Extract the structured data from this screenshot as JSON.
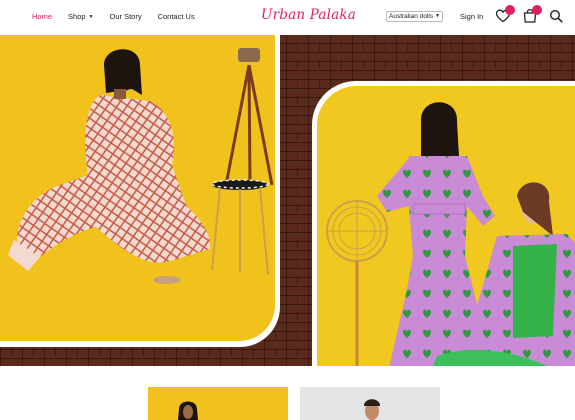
{
  "nav": {
    "items": [
      {
        "label": "Home",
        "active": true
      },
      {
        "label": "Shop",
        "has_dropdown": true
      },
      {
        "label": "Our Story"
      },
      {
        "label": "Contact Us"
      }
    ]
  },
  "brand": {
    "logo_text": "Urban Palaka",
    "accent_color": "#e0205e"
  },
  "currency": {
    "selected": "Australian dolls"
  },
  "account": {
    "sign_in": "Sign In"
  },
  "icons": {
    "wishlist": "heart-icon",
    "cart": "shopping-bag-icon",
    "search": "search-icon"
  },
  "hero": {
    "slides_count": 5,
    "active_slide": 2,
    "backdrop": "brick-wall",
    "left_photo": "model in checked jumpsuit on yellow backdrop",
    "right_photo": "two models in lilac heart-print outfits with fan"
  },
  "colors": {
    "yellow": "#f2c21c",
    "brick": "#5a2a1d",
    "lilac": "#c98bd6",
    "green": "#35b34a"
  }
}
